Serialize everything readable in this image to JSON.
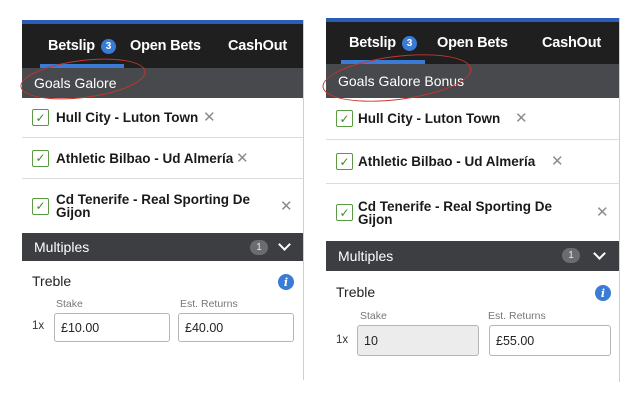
{
  "left": {
    "tabs": {
      "betslip": "Betslip",
      "betslip_count": "3",
      "open_bets": "Open Bets",
      "cashout": "CashOut"
    },
    "promo_title": "Goals Galore",
    "selections": [
      {
        "name": "Hull City - Luton Town"
      },
      {
        "name": "Athletic Bilbao - Ud Almería"
      },
      {
        "name": "Cd Tenerife - Real Sporting De Gijon"
      }
    ],
    "multiples": {
      "label": "Multiples",
      "count": "1"
    },
    "bet": {
      "type": "Treble",
      "multiplier": "1x",
      "stake_label": "Stake",
      "stake_value": "£10.00",
      "returns_label": "Est. Returns",
      "returns_value": "£40.00"
    }
  },
  "right": {
    "tabs": {
      "betslip": "Betslip",
      "betslip_count": "3",
      "open_bets": "Open Bets",
      "cashout": "CashOut"
    },
    "promo_title": "Goals Galore Bonus",
    "selections": [
      {
        "name": "Hull City - Luton Town"
      },
      {
        "name": "Athletic Bilbao - Ud Almería"
      },
      {
        "name": "Cd Tenerife - Real Sporting De Gijon"
      }
    ],
    "multiples": {
      "label": "Multiples",
      "count": "1"
    },
    "bet": {
      "type": "Treble",
      "multiplier": "1x",
      "stake_label": "Stake",
      "stake_value": "10",
      "returns_label": "Est. Returns",
      "returns_value": "£55.00"
    }
  },
  "colors": {
    "header_bg": "#1f1f1f",
    "accent_blue": "#3a7bd5",
    "subheader_bg": "#47494d",
    "check_green": "#5a9a45",
    "annotation_red": "#c8352b"
  },
  "icons": {
    "check": "check-icon",
    "close": "close-icon",
    "info": "info-icon",
    "chevron": "chevron-down-icon"
  }
}
